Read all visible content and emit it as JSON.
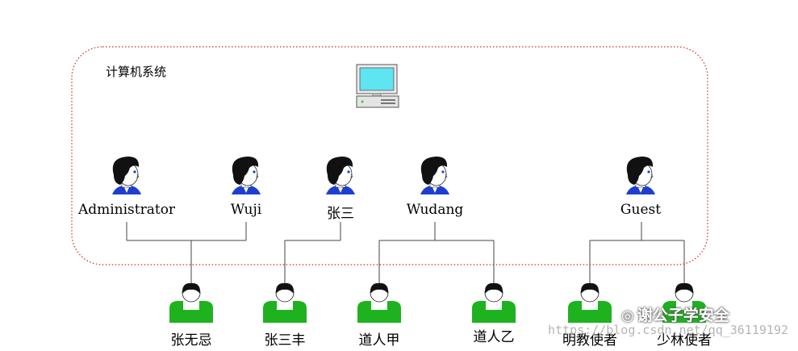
{
  "system": {
    "title": "计算机系统",
    "computer_icon": "desktop-computer-icon",
    "border_color": "#e02020"
  },
  "accounts": [
    {
      "id": "administrator",
      "label": "Administrator",
      "icon": "user-head-icon"
    },
    {
      "id": "wuji",
      "label": "Wuji",
      "icon": "user-head-icon"
    },
    {
      "id": "zhangsan",
      "label": "张三",
      "icon": "user-head-icon"
    },
    {
      "id": "wudang",
      "label": "Wudang",
      "icon": "user-head-icon"
    },
    {
      "id": "guest",
      "label": "Guest",
      "icon": "user-head-icon"
    }
  ],
  "users": [
    {
      "id": "zhangwuji",
      "label": "张无忌",
      "icon": "person-icon"
    },
    {
      "id": "zhangsanfeng",
      "label": "张三丰",
      "icon": "person-icon"
    },
    {
      "id": "daorenjia",
      "label": "道人甲",
      "icon": "person-icon"
    },
    {
      "id": "daorenyi",
      "label": "道人乙",
      "icon": "person-icon"
    },
    {
      "id": "mingjiao",
      "label": "明教使者",
      "icon": "person-icon"
    },
    {
      "id": "shaolin",
      "label": "少林使者",
      "icon": "person-icon"
    }
  ],
  "watermark": {
    "url_text": "https://blog.csdn.net/qq_36119192",
    "brand_text": "谢公子学安全",
    "brand_icon": "wechat-icon"
  },
  "colors": {
    "person_green": "#1fb21f",
    "tie_blue": "#1d3fd1",
    "screen_cyan": "#5fe4f2",
    "line": "#444444"
  }
}
